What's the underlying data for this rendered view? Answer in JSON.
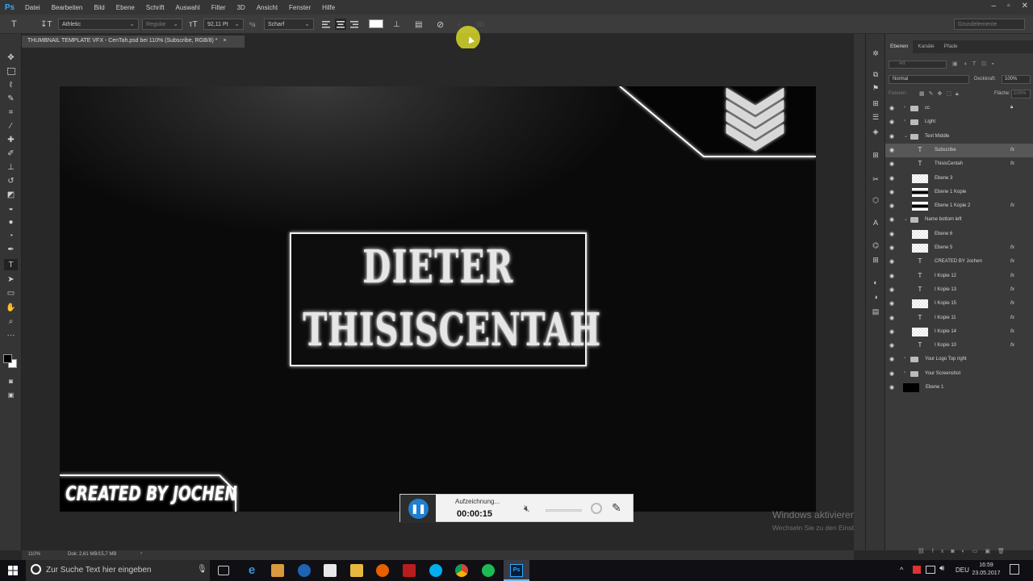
{
  "app": {
    "logo": "Ps"
  },
  "menu": [
    "Datei",
    "Bearbeiten",
    "Bild",
    "Ebene",
    "Schrift",
    "Auswahl",
    "Filter",
    "3D",
    "Ansicht",
    "Fenster",
    "Hilfe"
  ],
  "options": {
    "font_family": "Athletic",
    "font_style": "Regular",
    "font_size": "92,11 Pt",
    "antialias": "Scharf",
    "threed_label": "3D",
    "workspace": "Grundelemente"
  },
  "document": {
    "tab_title": "THUMBNAIL TEMPLATE VFX - CenTah.psd bei 110% (Subscribe, RGB/8) *",
    "close": "×"
  },
  "artwork": {
    "line1": "DIETER",
    "line2": "THISISCENTAH",
    "footer": "CREATED BY JOCHEN"
  },
  "recorder": {
    "status": "Aufzeichnung...",
    "time": "00:00:15"
  },
  "watermark": {
    "title": "Windows aktivieren",
    "subtitle": "Wechseln Sie zu den Einstellungen, um Windows zu aktivieren."
  },
  "panel": {
    "tabs": [
      "Ebenen",
      "Kanäle",
      "Pfade"
    ],
    "search_placeholder": "Art",
    "blend_mode": "Normal",
    "opacity_label": "Deckkraft:",
    "opacity_value": "100%",
    "lock_label": "Fixieren:",
    "fill_label": "Fläche:",
    "fill_value": "100%"
  },
  "layers": [
    {
      "name": "cc",
      "type": "group",
      "indent": 0,
      "fx": false,
      "selected": false,
      "lock": true
    },
    {
      "name": "Light",
      "type": "group",
      "indent": 0,
      "fx": false,
      "selected": false
    },
    {
      "name": "Text Middle",
      "type": "group-open",
      "indent": 0,
      "fx": false,
      "selected": false
    },
    {
      "name": "Subscribe",
      "type": "text",
      "indent": 1,
      "fx": true,
      "selected": true
    },
    {
      "name": "ThisisCentah",
      "type": "text",
      "indent": 1,
      "fx": true,
      "selected": false
    },
    {
      "name": "Ebene 3",
      "type": "pixel",
      "indent": 1,
      "fx": false,
      "selected": false
    },
    {
      "name": "Ebene 1 Kopie",
      "type": "bar",
      "indent": 1,
      "fx": false,
      "selected": false
    },
    {
      "name": "Ebene 1 Kopie 2",
      "type": "bar",
      "indent": 1,
      "fx": true,
      "selected": false
    },
    {
      "name": "Name bottom left",
      "type": "group-open",
      "indent": 0,
      "fx": false,
      "selected": false
    },
    {
      "name": "Ebene 6",
      "type": "pixel",
      "indent": 1,
      "fx": false,
      "selected": false
    },
    {
      "name": "Ebene 5",
      "type": "pixel",
      "indent": 1,
      "fx": true,
      "selected": false
    },
    {
      "name": "CREATED BY Jochen",
      "type": "text",
      "indent": 1,
      "fx": true,
      "selected": false
    },
    {
      "name": "I Kopie 12",
      "type": "text",
      "indent": 1,
      "fx": true,
      "selected": false
    },
    {
      "name": "I Kopie 13",
      "type": "text",
      "indent": 1,
      "fx": true,
      "selected": false
    },
    {
      "name": "I Kopie 15",
      "type": "pixel",
      "indent": 1,
      "fx": true,
      "selected": false
    },
    {
      "name": "I Kopie 11",
      "type": "text",
      "indent": 1,
      "fx": true,
      "selected": false
    },
    {
      "name": "I Kopie 14",
      "type": "pixel",
      "indent": 1,
      "fx": true,
      "selected": false
    },
    {
      "name": "I Kopie 10",
      "type": "text",
      "indent": 1,
      "fx": true,
      "selected": false
    },
    {
      "name": "Your Logo Top right",
      "type": "group",
      "indent": 0,
      "fx": false,
      "selected": false
    },
    {
      "name": "Your Screenshot",
      "type": "group",
      "indent": 0,
      "fx": false,
      "selected": false
    },
    {
      "name": "Ebene 1",
      "type": "black",
      "indent": 0,
      "fx": false,
      "selected": false
    }
  ],
  "layer_fx_label": "fx",
  "status": {
    "zoom": "110%",
    "doc_info": "Dok: 2,61 MB/15,7 MB"
  },
  "taskbar": {
    "search_placeholder": "Zur Suche Text hier eingeben",
    "lang": "DEU",
    "time": "16:59",
    "date": "23.05.2017"
  }
}
